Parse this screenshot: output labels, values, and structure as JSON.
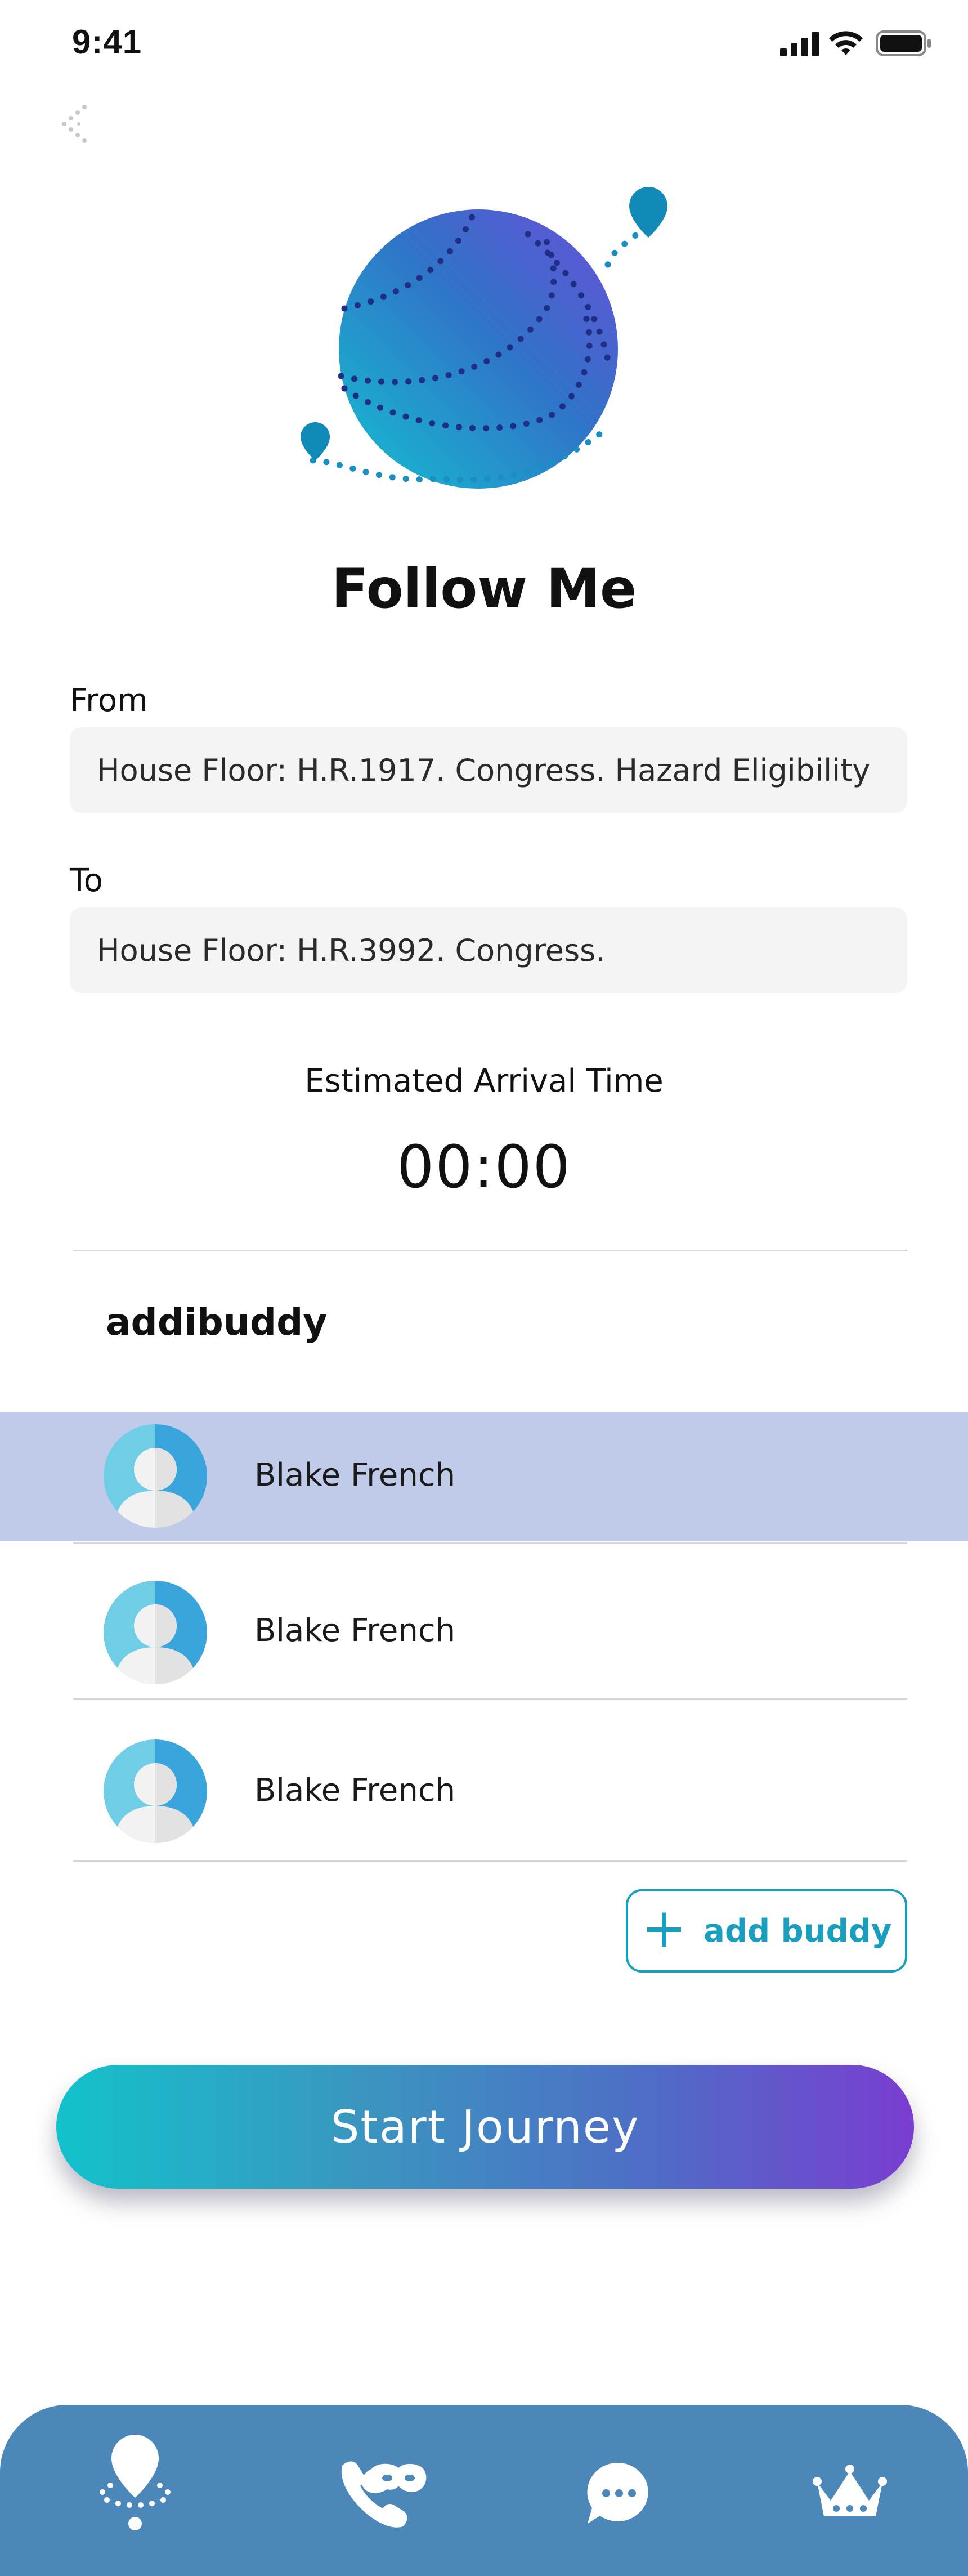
{
  "status_bar": {
    "time": "9:41"
  },
  "header": {
    "title": "Follow Me"
  },
  "route": {
    "from_label": "From",
    "from_value": "House Floor: H.R.1917. Congress. Hazard Eligibility",
    "to_label": "To",
    "to_value": "House Floor: H.R.3992. Congress."
  },
  "eta": {
    "label": "Estimated Arrival Time",
    "value": "00:00"
  },
  "buddies": {
    "title": "addibuddy",
    "items": [
      {
        "name": "Blake French",
        "selected": true
      },
      {
        "name": "Blake French",
        "selected": false
      },
      {
        "name": "Blake French",
        "selected": false
      }
    ],
    "add_label": "add buddy"
  },
  "start_button": {
    "label": "Start Journey"
  },
  "tabbar": {
    "items": [
      {
        "icon": "location-pin-icon",
        "active": true
      },
      {
        "icon": "phone-mask-icon",
        "active": false
      },
      {
        "icon": "chat-bubble-icon",
        "active": false
      },
      {
        "icon": "crown-icon",
        "active": false
      }
    ]
  },
  "colors": {
    "accent": "#1a9ec0",
    "selected_row": "#bfcbe9",
    "tabbar": "#4b87b8",
    "globe_start": "#14c0d0",
    "globe_end": "#6a4fd8"
  }
}
